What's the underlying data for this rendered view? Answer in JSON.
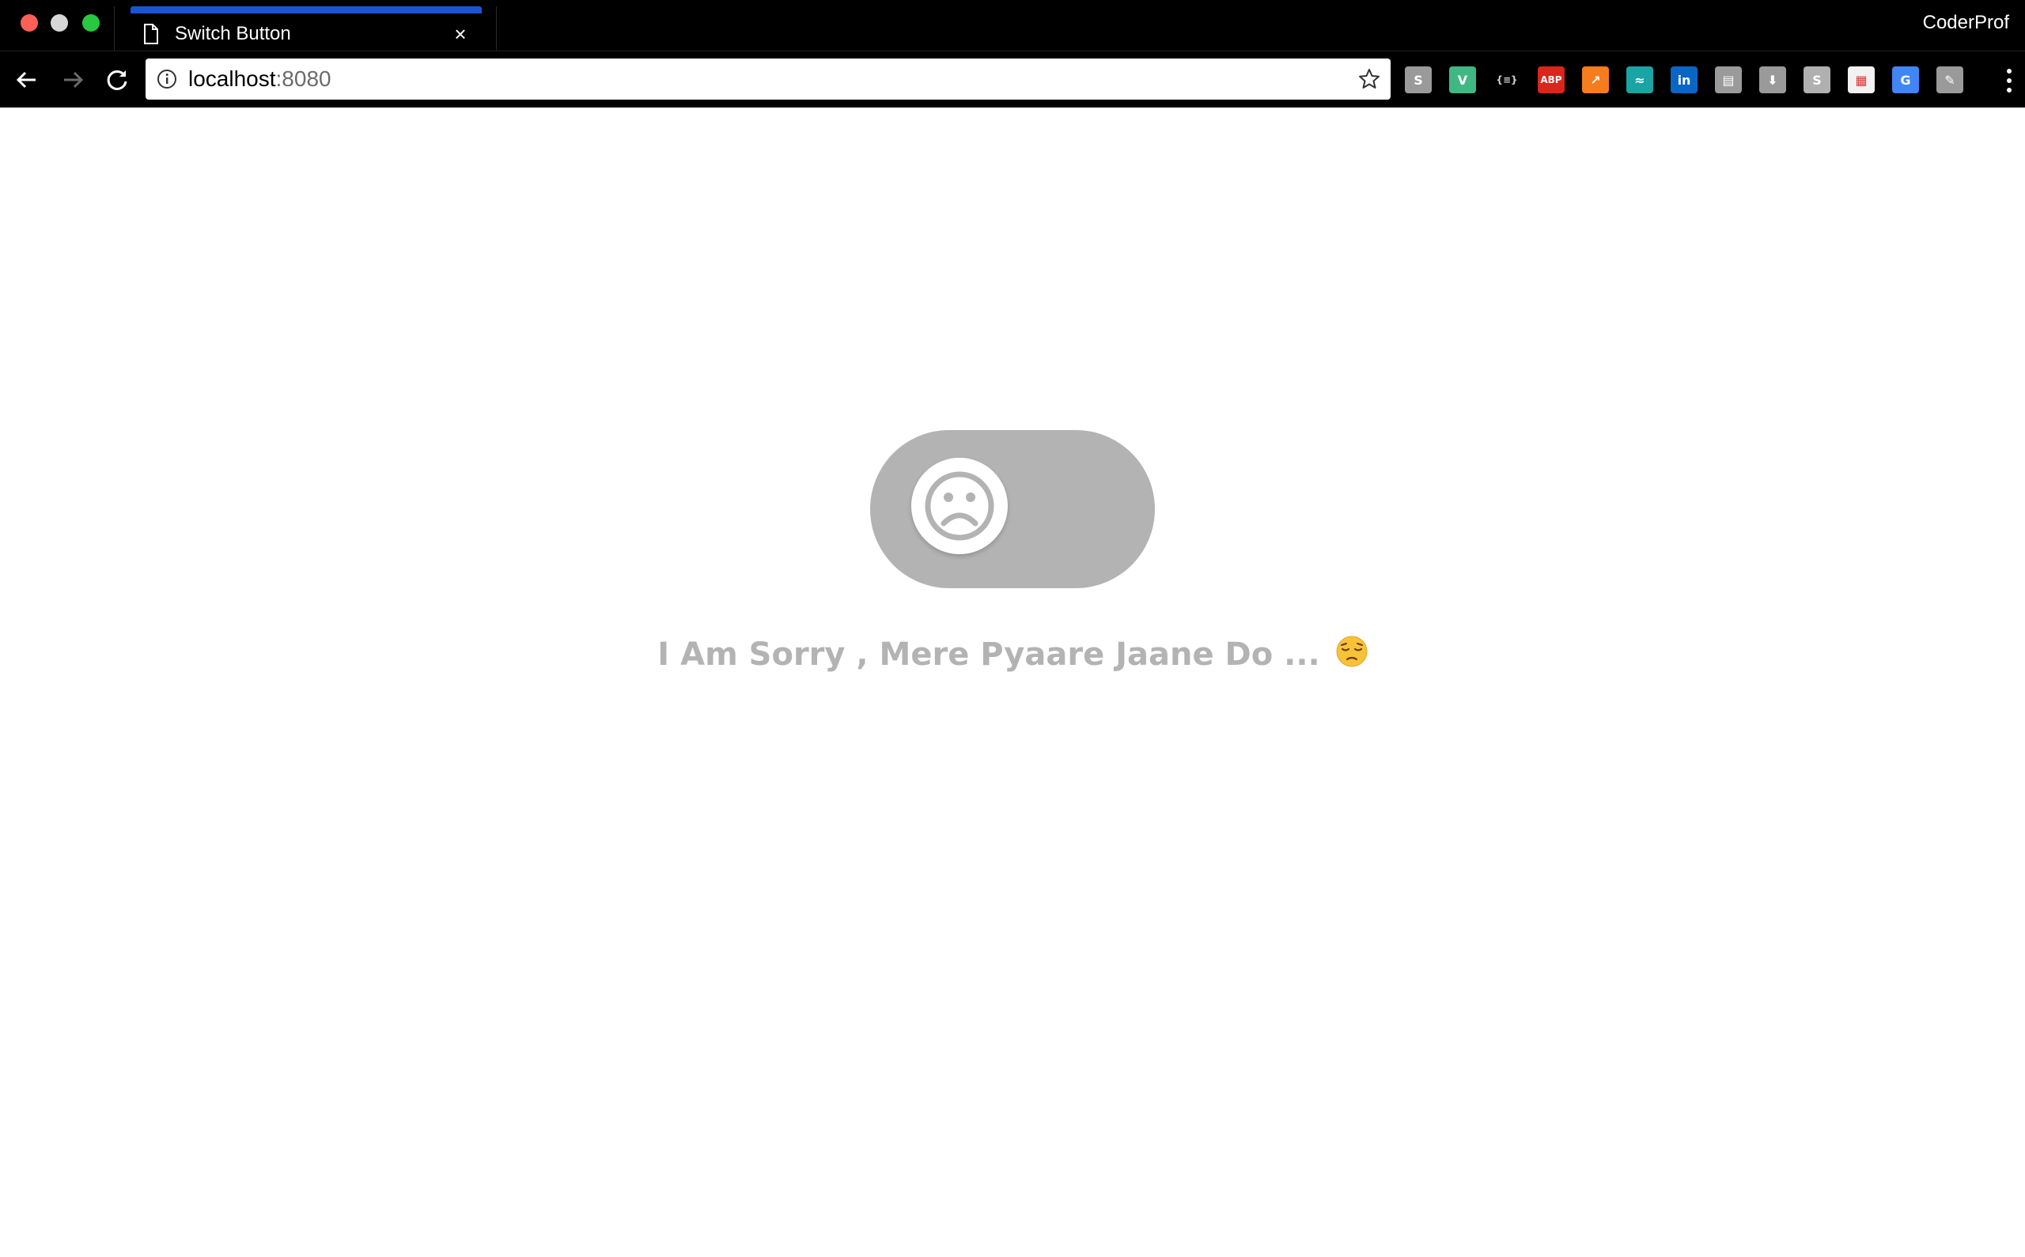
{
  "browser": {
    "tab": {
      "title": "Switch Button",
      "close_glyph": "×"
    },
    "profile": "CoderProf",
    "address": {
      "host": "localhost",
      "port": ":8080"
    },
    "extensions": [
      {
        "name": "skype-icon",
        "glyph": "S",
        "color": "#9a9a9a"
      },
      {
        "name": "vue-devtools-icon",
        "glyph": "V",
        "color": "#41b883"
      },
      {
        "name": "json-formatter-icon",
        "glyph": "{≡}",
        "color": "#000000"
      },
      {
        "name": "adblock-plus-icon",
        "glyph": "ABP",
        "color": "#d7261c"
      },
      {
        "name": "analytics-icon",
        "glyph": "↗",
        "color": "#f57c1f"
      },
      {
        "name": "wave-icon",
        "glyph": "≈",
        "color": "#1aa4a4"
      },
      {
        "name": "linkedin-icon",
        "glyph": "in",
        "color": "#0a66c2"
      },
      {
        "name": "document-icon",
        "glyph": "▤",
        "color": "#9a9a9a"
      },
      {
        "name": "download-icon",
        "glyph": "⬇",
        "color": "#9a9a9a"
      },
      {
        "name": "s-extension-icon",
        "glyph": "S",
        "color": "#b0b0b0"
      },
      {
        "name": "calendar-icon",
        "glyph": "▦",
        "color": "#f2f2f2"
      },
      {
        "name": "google-translate-icon",
        "glyph": "G",
        "color": "#4285f4"
      },
      {
        "name": "dev-tool-icon",
        "glyph": "✎",
        "color": "#9a9a9a"
      }
    ]
  },
  "page": {
    "switch_state": "off",
    "caption": "I Am Sorry , Mere Pyaare Jaane Do ..."
  }
}
